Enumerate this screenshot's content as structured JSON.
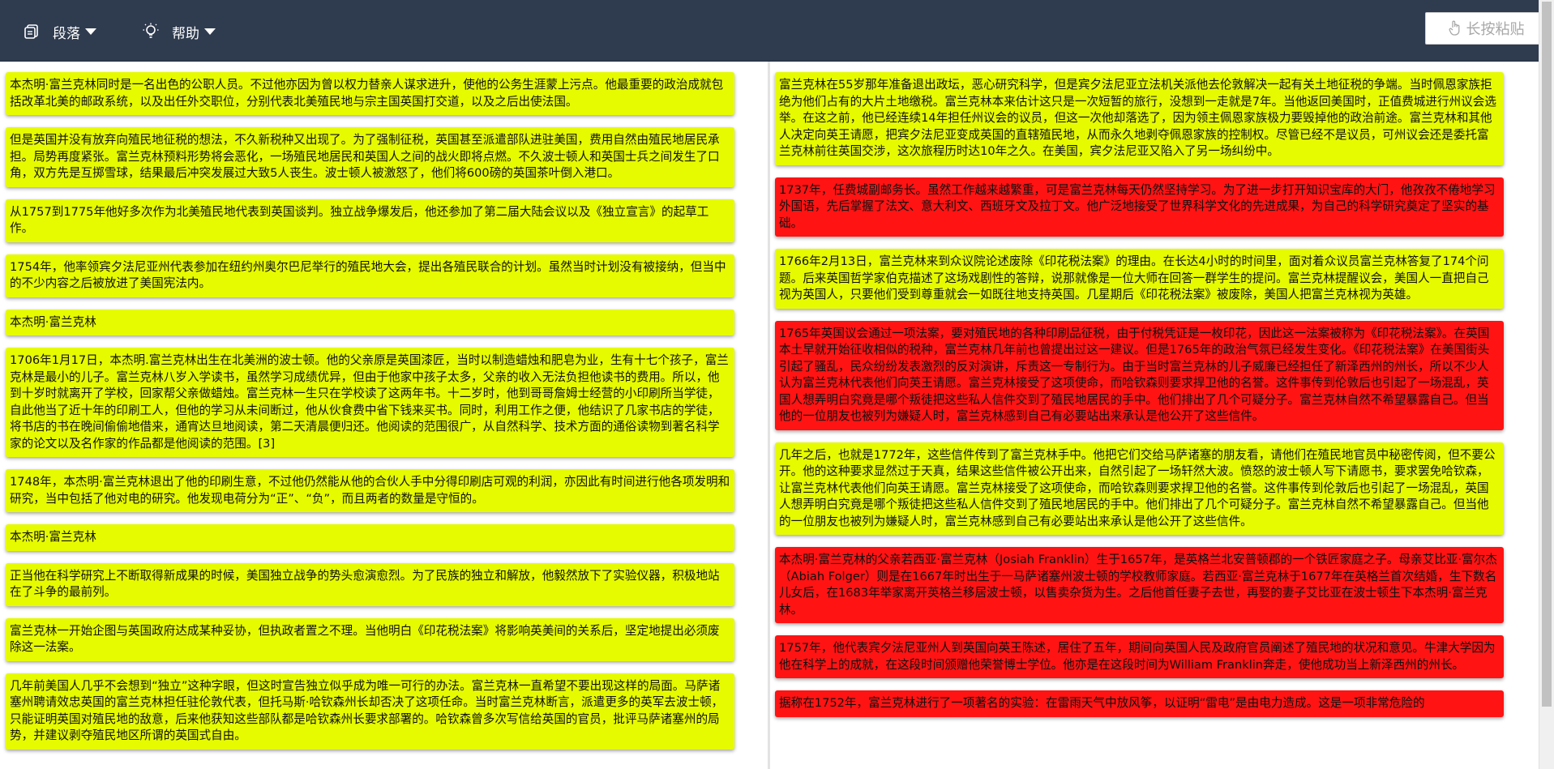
{
  "toolbar": {
    "paragraph_label": "段落",
    "help_label": "帮助",
    "paste_label": "长按粘贴"
  },
  "colors": {
    "toolbar_bg": "#2f3b4f",
    "card_yellow": "#e6fb00",
    "card_red": "#ff1313"
  },
  "icons": {
    "paragraph": "document-copy-icon",
    "help": "bulb-icon",
    "paste": "hand-pointer-icon"
  },
  "left_cards": [
    {
      "text": "本杰明·富兰克林同时是一名出色的公职人员。不过他亦因为曾以权力替亲人谋求进升，使他的公务生涯蒙上污点。他最重要的政治成就包括改革北美的邮政系统，以及出任外交职位，分别代表北美殖民地与宗主国英国打交道，以及之后出使法国。"
    },
    {
      "text": "但是英国并没有放弃向殖民地征税的想法，不久新税种又出现了。为了强制征税，英国甚至派遣部队进驻美国，费用自然由殖民地居民承担。局势再度紧张。富兰克林预料形势将会恶化，一场殖民地居民和英国人之间的战火即将点燃。不久波士顿人和英国士兵之间发生了口角，双方先是互掷雪球，结果最后冲突发展过大致5人丧生。波士顿人被激怒了，他们将600磅的英国茶叶倒入港口。"
    },
    {
      "text": "从1757到1775年他好多次作为北美殖民地代表到英国谈判。独立战争爆发后，他还参加了第二届大陆会议以及《独立宣言》的起草工作。"
    },
    {
      "text": "1754年，他率领宾夕法尼亚州代表参加在纽约州奥尔巴尼举行的殖民地大会，提出各殖民联合的计划。虽然当时计划没有被接纳，但当中的不少内容之后被放进了美国宪法内。"
    },
    {
      "text": "本杰明·富兰克林"
    },
    {
      "text": "1706年1月17日，本杰明.富兰克林出生在北美洲的波士顿。他的父亲原是英国漆匠，当时以制造蜡烛和肥皂为业，生有十七个孩子，富兰克林是最小的儿子。富兰克林八岁入学读书，虽然学习成绩优异，但由于他家中孩子太多，父亲的收入无法负担他读书的费用。所以，他到十岁时就离开了学校，回家帮父亲做蜡烛。富兰克林一生只在学校读了这两年书。十二岁时，他到哥哥詹姆士经营的小印刷所当学徒，自此他当了近十年的印刷工人，但他的学习从未间断过，他从伙食费中省下钱来买书。同时，利用工作之便，他结识了几家书店的学徒，将书店的书在晚间偷偷地借来，通宵达旦地阅读，第二天清晨便归还。他阅读的范围很广，从自然科学、技术方面的通俗读物到著名科学家的论文以及名作家的作品都是他阅读的范围。[3]"
    },
    {
      "text": "1748年，本杰明·富兰克林退出了他的印刷生意，不过他仍然能从他的合伙人手中分得印刷店可观的利润，亦因此有时间进行他各项发明和研究，当中包括了他对电的研究。他发现电荷分为“正”、“负”，而且两者的数量是守恒的。"
    },
    {
      "text": "本杰明·富兰克林"
    },
    {
      "text": "正当他在科学研究上不断取得新成果的时候，美国独立战争的势头愈演愈烈。为了民族的独立和解放，他毅然放下了实验仪器，积极地站在了斗争的最前列。"
    },
    {
      "text": "富兰克林一开始企图与英国政府达成某种妥协，但执政者置之不理。当他明白《印花税法案》将影响英美间的关系后，坚定地提出必须废除这一法案。"
    },
    {
      "text": "几年前美国人几乎不会想到“独立”这种字眼，但这时宣告独立似乎成为唯一可行的办法。富兰克林一直希望不要出现这样的局面。马萨诸塞州聘请效忠英国的富兰克林担任驻伦敦代表，但托马斯·哈钦森州长却否决了这项任命。当时富兰克林断言，派遣更多的英军去波士顿，只能证明英国对殖民地的敌意，后来他获知这些部队都是哈钦森州长要求部署的。哈钦森曾多次写信给英国的官员，批评马萨诸塞州的局势，并建议剥夺殖民地区所谓的英国式自由。"
    }
  ],
  "right_cards": [
    {
      "text": "富兰克林在55岁那年准备退出政坛，恶心研究科学，但是宾夕法尼亚立法机关派他去伦敦解决一起有关土地征税的争端。当时佩恩家族拒绝为他们占有的大片土地缴税。富兰克林本来估计这只是一次短暂的旅行，没想到一走就是7年。当他返回美国时，正值费城进行州议会选举。在这之前，他已经连续14年担任州议会的议员，但这一次他却落选了，因为领主佩恩家族极力要毁掉他的政治前途。富兰克林和其他人决定向英王请愿，把宾夕法尼亚变成英国的直辖殖民地，从而永久地剥夺佩恩家族的控制权。尽管已经不是议员，可州议会还是委托富兰克林前往英国交涉，这次旅程历时达10年之久。在美国，宾夕法尼亚又陷入了另一场纠纷中。"
    },
    {
      "text": "1737年，任费城副邮务长。虽然工作越来越繁重，可是富兰克林每天仍然坚持学习。为了进一步打开知识宝库的大门，他孜孜不倦地学习外国语，先后掌握了法文、意大利文、西班牙文及拉丁文。他广泛地接受了世界科学文化的先进成果，为自己的科学研究奠定了坚实的基础。"
    },
    {
      "text": "1766年2月13日，富兰克林来到众议院论述废除《印花税法案》的理由。在长达4小时的时间里，面对着众议员富兰克林答复了174个问题。后来英国哲学家伯克描述了这场戏剧性的答辩，说那就像是一位大师在回答一群学生的提问。富兰克林提醒议会，美国人一直把自己视为英国人，只要他们受到尊重就会一如既往地支持英国。几星期后《印花税法案》被废除，美国人把富兰克林视为英雄。"
    },
    {
      "text": "1765年英国议会通过一项法案，要对殖民地的各种印刷品征税，由于付税凭证是一枚印花，因此这一法案被称为《印花税法案》。在英国本土早就开始征收相似的税种，富兰克林几年前也曾提出过这一建议。但是1765年的政治气氛已经发生变化。《印花税法案》在美国街头引起了骚乱，民众纷纷发表激烈的反对演讲，斥责这一专制行为。由于当时富兰克林的儿子威廉已经担任了新泽西州的州长，所以不少人认为富兰克林代表他们向英王请愿。富兰克林接受了这项使命，而哈钦森则要求捍卫他的名誉。这件事传到伦敦后也引起了一场混乱，英国人想弄明白究竟是哪个叛徒把这些私人信件交到了殖民地居民的手中。他们排出了几个可疑分子。富兰克林自然不希望暴露自己。但当他的一位朋友也被列为嫌疑人时，富兰克林感到自己有必要站出来承认是他公开了这些信件。"
    },
    {
      "text": "几年之后，也就是1772年，这些信件传到了富兰克林手中。他把它们交给马萨诸塞的朋友看，请他们在殖民地官员中秘密传阅，但不要公开。他的这种要求显然过于天真，结果这些信件被公开出来，自然引起了一场轩然大波。愤怒的波士顿人写下请愿书，要求罢免哈钦森，让富兰克林代表他们向英王请愿。富兰克林接受了这项使命，而哈钦森则要求捍卫他的名誉。这件事传到伦敦后也引起了一场混乱，英国人想弄明白究竟是哪个叛徒把这些私人信件交到了殖民地居民的手中。他们排出了几个可疑分子。富兰克林自然不希望暴露自己。但当他的一位朋友也被列为嫌疑人时，富兰克林感到自己有必要站出来承认是他公开了这些信件。"
    },
    {
      "text": "本杰明·富兰克林的父亲若西亚·富兰克林（Josiah Franklin）生于1657年，是英格兰北安普顿郡的一个铁匠家庭之子。母亲艾比亚·富尔杰（Abiah Folger）则是在1667年时出生于一马萨诸塞州波士顿的学校教师家庭。若西亚·富兰克林于1677年在英格兰首次结婚，生下数名儿女后，在1683年举家离开英格兰移居波士顿，以售卖杂货为生。之后他首任妻子去世，再娶的妻子艾比亚在波士顿生下本杰明·富兰克林。"
    },
    {
      "text": "1757年，他代表宾夕法尼亚州人到英国向英王陈述，居住了五年，期间向英国人民及政府官员阐述了殖民地的状况和意见。牛津大学因为他在科学上的成就，在这段时间颁赠他荣誉博士学位。他亦是在这段时间为William Franklin奔走，使他成功当上新泽西州的州长。"
    },
    {
      "text": "据称在1752年，富兰克林进行了一项著名的实验：在雷雨天气中放风筝，以证明“雷电”是由电力造成。这是一项非常危险的"
    }
  ]
}
